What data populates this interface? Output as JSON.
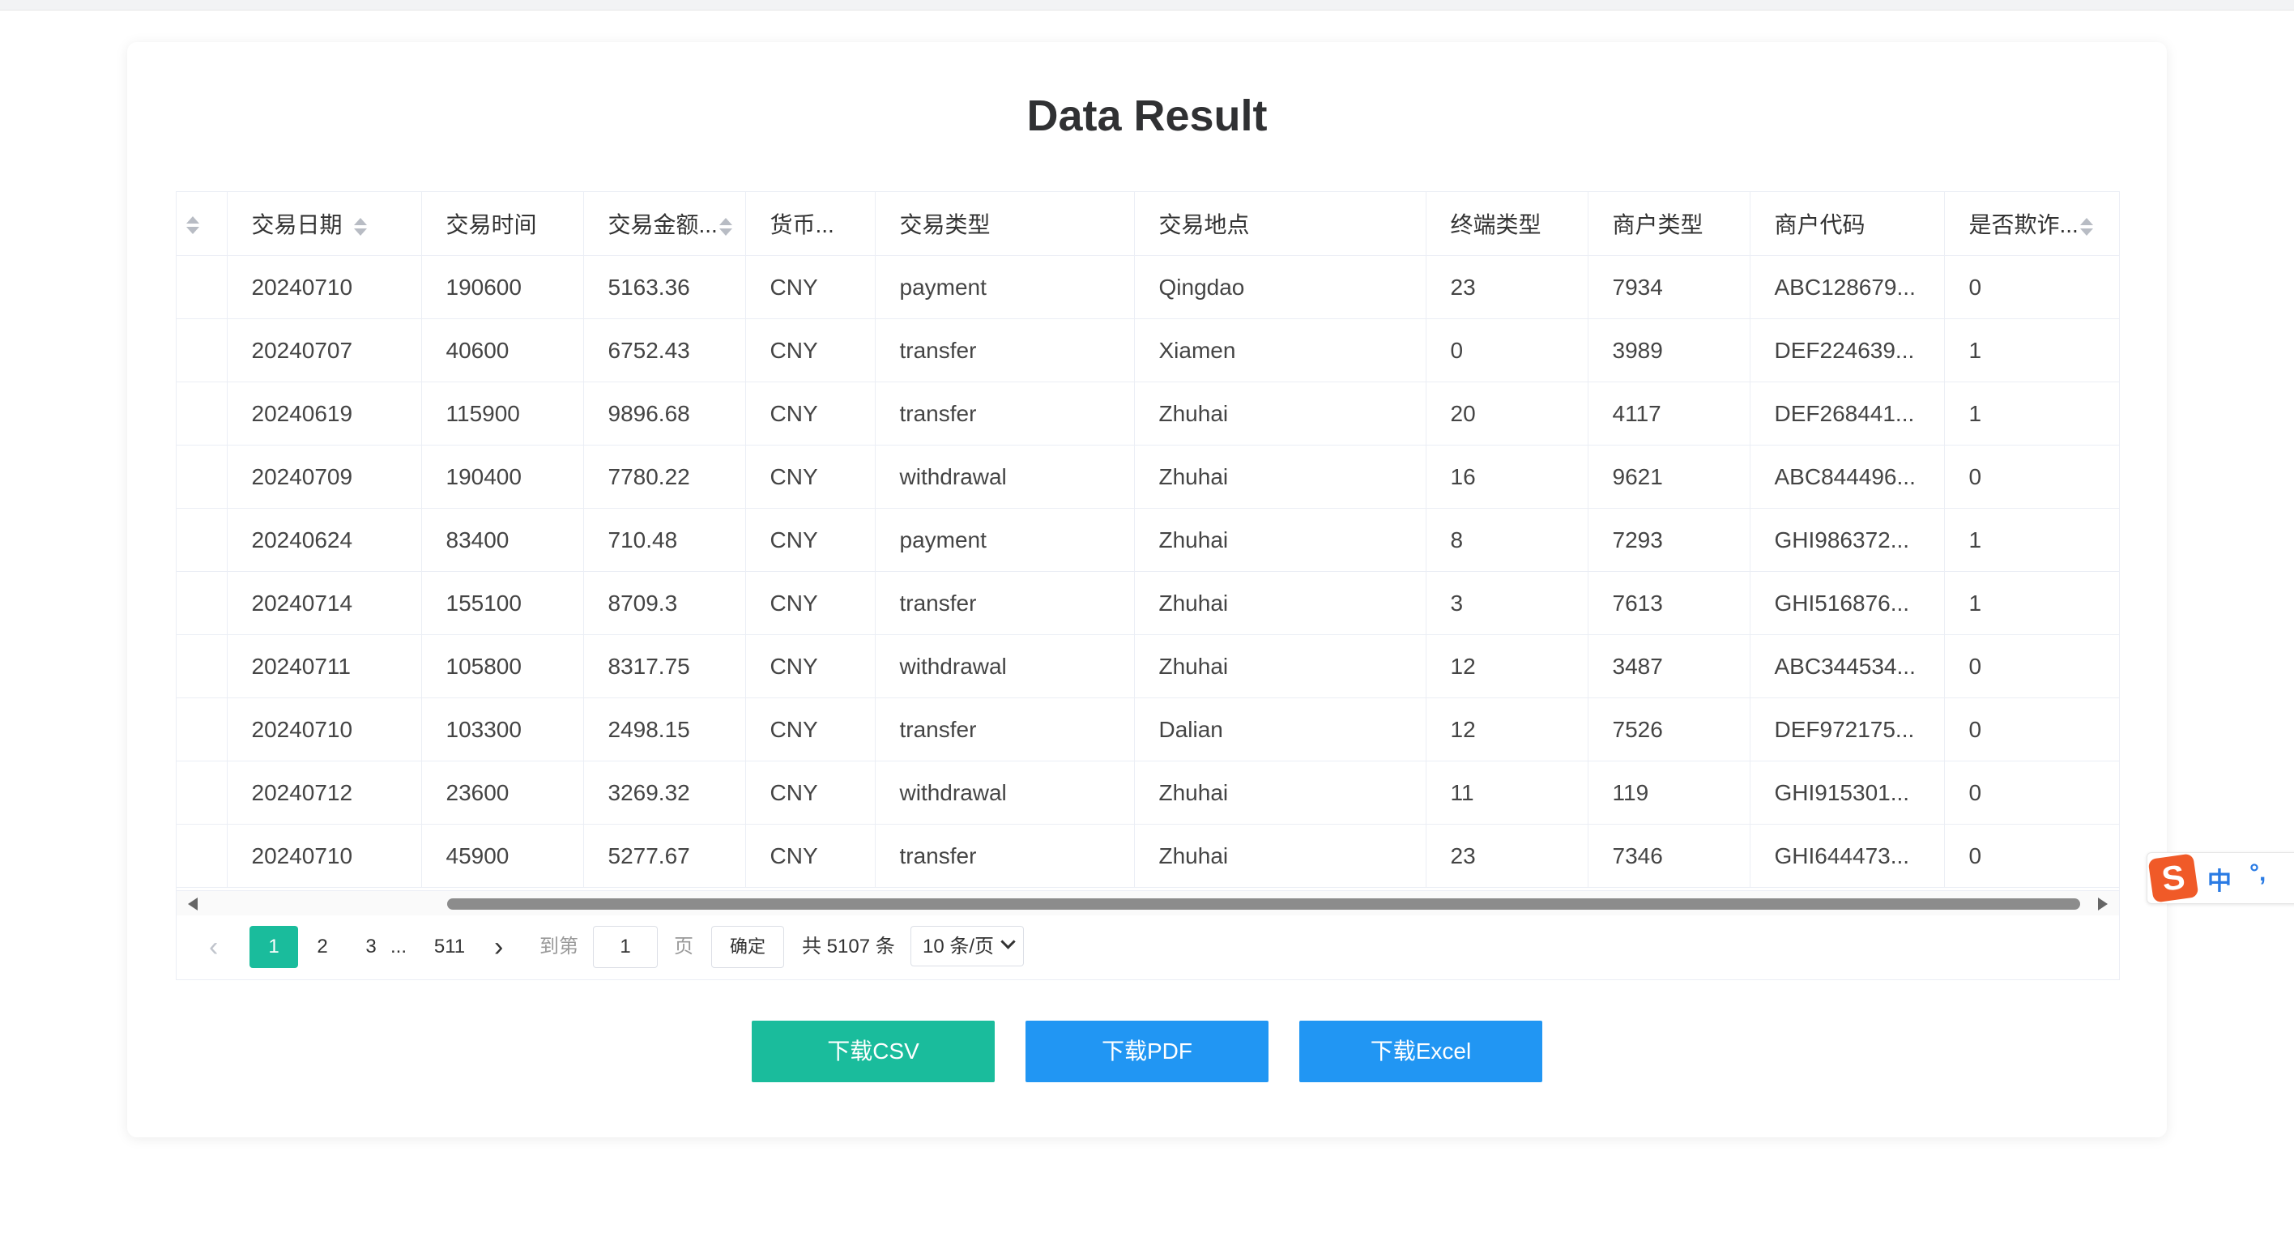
{
  "page": {
    "title": "Data Result"
  },
  "table": {
    "headers": [
      "交易日期",
      "交易时间",
      "交易金额...",
      "货币...",
      "交易类型",
      "交易地点",
      "终端类型",
      "商户类型",
      "商户代码",
      "是否欺诈..."
    ],
    "rows": [
      [
        "20240710",
        "190600",
        "5163.36",
        "CNY",
        "payment",
        "Qingdao",
        "23",
        "7934",
        "ABC128679...",
        "0"
      ],
      [
        "20240707",
        "40600",
        "6752.43",
        "CNY",
        "transfer",
        "Xiamen",
        "0",
        "3989",
        "DEF224639...",
        "1"
      ],
      [
        "20240619",
        "115900",
        "9896.68",
        "CNY",
        "transfer",
        "Zhuhai",
        "20",
        "4117",
        "DEF268441...",
        "1"
      ],
      [
        "20240709",
        "190400",
        "7780.22",
        "CNY",
        "withdrawal",
        "Zhuhai",
        "16",
        "9621",
        "ABC844496...",
        "0"
      ],
      [
        "20240624",
        "83400",
        "710.48",
        "CNY",
        "payment",
        "Zhuhai",
        "8",
        "7293",
        "GHI986372...",
        "1"
      ],
      [
        "20240714",
        "155100",
        "8709.3",
        "CNY",
        "transfer",
        "Zhuhai",
        "3",
        "7613",
        "GHI516876...",
        "1"
      ],
      [
        "20240711",
        "105800",
        "8317.75",
        "CNY",
        "withdrawal",
        "Zhuhai",
        "12",
        "3487",
        "ABC344534...",
        "0"
      ],
      [
        "20240710",
        "103300",
        "2498.15",
        "CNY",
        "transfer",
        "Dalian",
        "12",
        "7526",
        "DEF972175...",
        "0"
      ],
      [
        "20240712",
        "23600",
        "3269.32",
        "CNY",
        "withdrawal",
        "Zhuhai",
        "11",
        "119",
        "GHI915301...",
        "0"
      ],
      [
        "20240710",
        "45900",
        "5277.67",
        "CNY",
        "transfer",
        "Zhuhai",
        "23",
        "7346",
        "GHI644473...",
        "0"
      ]
    ]
  },
  "pagination": {
    "pages": [
      "1",
      "2",
      "3",
      "...",
      "511"
    ],
    "current": "1",
    "goto_label": "到第",
    "goto_value": "1",
    "page_unit": "页",
    "confirm_label": "确定",
    "total_label": "共 5107 条",
    "page_size_label": "10 条/页"
  },
  "buttons": {
    "csv": "下载CSV",
    "pdf": "下载PDF",
    "excel": "下载Excel"
  },
  "ime": {
    "mode": "中",
    "punct": "°,"
  },
  "colors": {
    "accent_teal": "#1abc9c",
    "accent_blue": "#2196f3",
    "ime_logo": "#f05a28"
  }
}
